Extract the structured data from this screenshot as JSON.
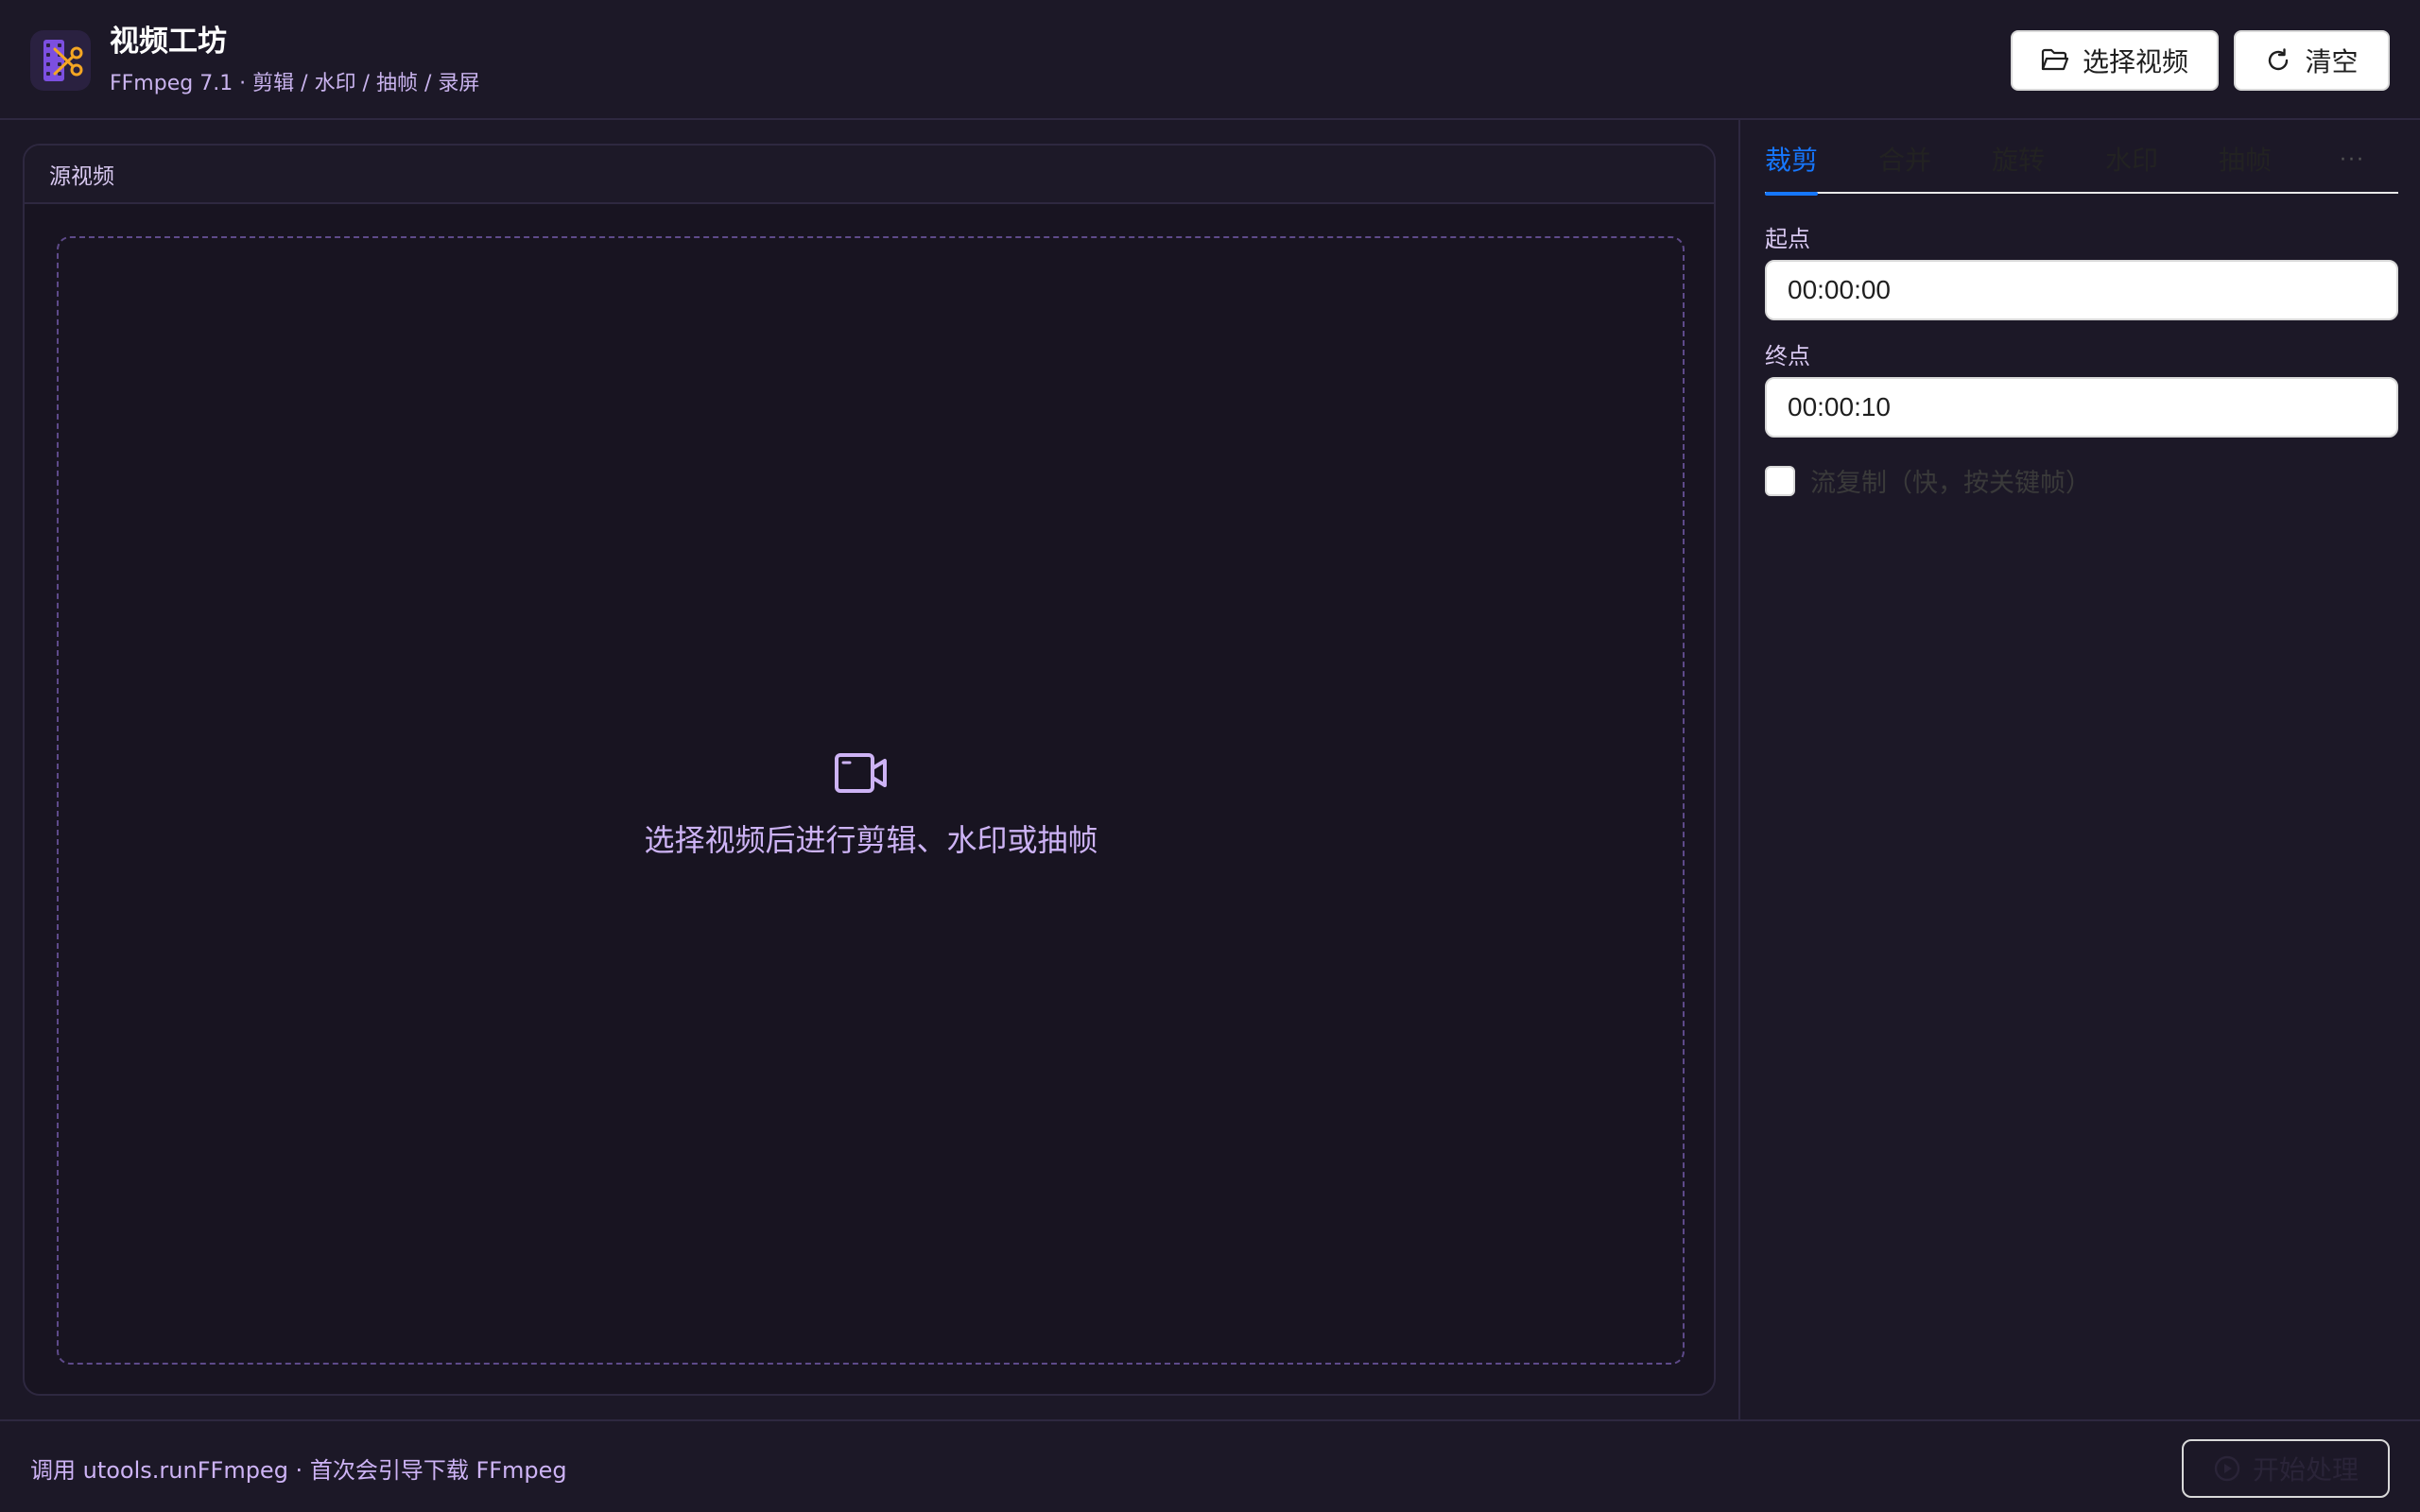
{
  "header": {
    "title": "视频工坊",
    "subtitle": "FFmpeg 7.1 · 剪辑 / 水印 / 抽帧 / 录屏",
    "select_button": "选择视频",
    "clear_button": "清空"
  },
  "source": {
    "heading": "源视频",
    "placeholder": "选择视频后进行剪辑、水印或抽帧"
  },
  "tabs": [
    {
      "label": "裁剪",
      "active": true
    },
    {
      "label": "合并",
      "active": false
    },
    {
      "label": "旋转",
      "active": false
    },
    {
      "label": "水印",
      "active": false
    },
    {
      "label": "抽帧",
      "active": false
    },
    {
      "label": "···",
      "active": false
    }
  ],
  "trim": {
    "start_label": "起点",
    "start_value": "00:00:00",
    "end_label": "终点",
    "end_value": "00:00:10",
    "stream_copy_label": "流复制（快，按关键帧）",
    "stream_copy_checked": false
  },
  "footer": {
    "note": "调用 utools.runFFmpeg · 首次会引导下载 FFmpeg",
    "start_button": "开始处理",
    "start_button_disabled": true
  },
  "colors": {
    "background": "#1c1827",
    "accent": "#1677ff",
    "brand_purple": "#7c4fe0",
    "scissors_orange": "#f5a623",
    "muted_text": "#cdb3f5"
  },
  "icons": {
    "logo": "film-scissors-logo",
    "select": "folder-open-icon",
    "clear": "refresh-icon",
    "placeholder": "video-camera-icon",
    "start": "play-circle-icon"
  }
}
